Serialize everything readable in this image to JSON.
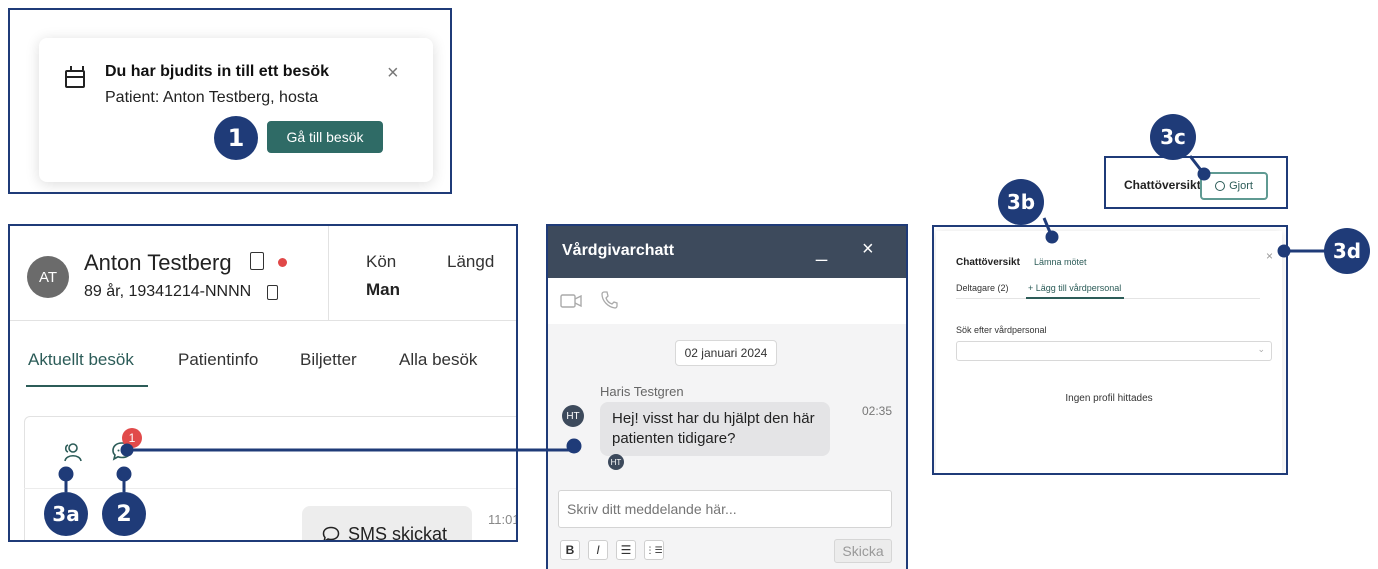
{
  "notification": {
    "title": "Du har bjudits in till ett besök",
    "subtitle": "Patient: Anton Testberg, hosta",
    "close": "×",
    "button": "Gå till besök"
  },
  "markers": {
    "m1": "1",
    "m2": "2",
    "m3a": "3a",
    "m3b": "3b",
    "m3c": "3c",
    "m3d": "3d"
  },
  "patient": {
    "initials": "AT",
    "name": "Anton Testberg",
    "info": "89 år, 19341214-NNNN",
    "gender_label": "Kön",
    "gender_value": "Man",
    "height_label": "Längd",
    "tabs": [
      "Aktuellt besök",
      "Patientinfo",
      "Biljetter",
      "Alla besök"
    ],
    "chat_badge": "1",
    "sms_text": "SMS skickat",
    "sms_time": "11:01"
  },
  "chat": {
    "title": "Vårdgivarchatt",
    "minimize": "_",
    "close": "×",
    "date": "02 januari 2024",
    "sender": "Haris Testgren",
    "sender_initials": "HT",
    "message": "Hej! visst har du hjälpt den här patienten tidigare?",
    "time": "02:35",
    "input_placeholder": "Skriv ditt meddelande här...",
    "format_bold": "B",
    "format_italic": "I",
    "format_bullets": "☰",
    "format_numbered": "⋮☰",
    "send": "Skicka"
  },
  "overview_crop": {
    "label": "Chattöversikt",
    "done_button": "Gjort"
  },
  "overview": {
    "title": "Chattöversikt",
    "leave": "Lämna mötet",
    "close": "×",
    "tab_participants": "Deltagare (2)",
    "tab_add": "+ Lägg till vårdpersonal",
    "search_label": "Sök efter vårdpersonal",
    "empty": "Ingen profil hittades"
  },
  "colors": {
    "frame": "#1f3b78",
    "accent": "#2c5c58",
    "chat_header": "#3d4a5c",
    "badge_red": "#e14a4a"
  }
}
